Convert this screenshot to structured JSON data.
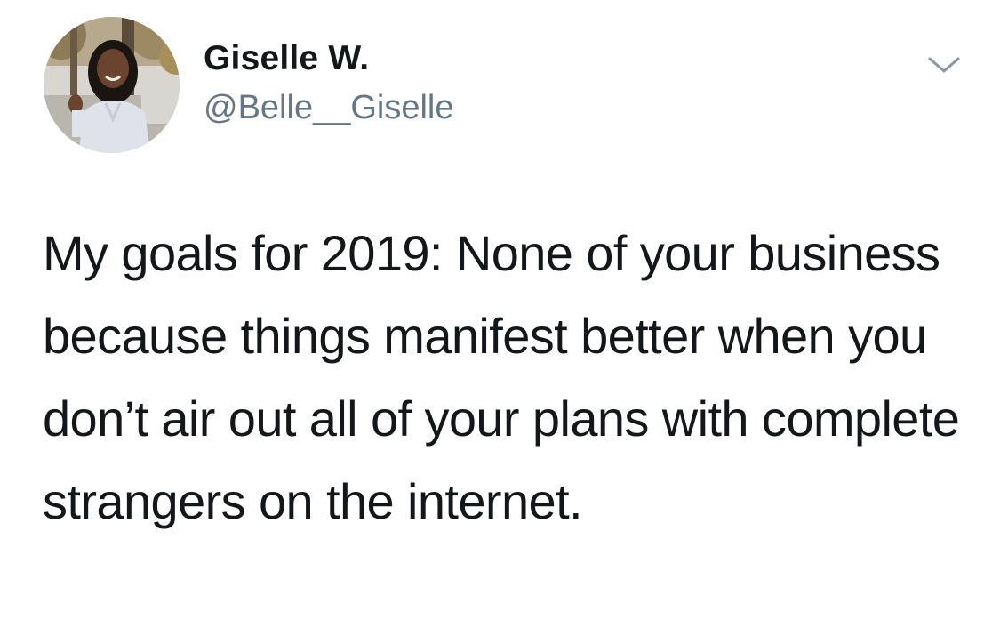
{
  "author": {
    "display_name": "Giselle W.",
    "handle": "@Belle__Giselle",
    "avatar_icon": "profile-photo"
  },
  "tweet": {
    "text": "My goals for 2019: None of your business because things manifest better when you don’t air out all of your plans with complete strangers on the internet."
  },
  "controls": {
    "more_icon": "chevron-down-icon"
  },
  "colors": {
    "text": "#14171a",
    "secondary": "#657786",
    "caret": "#8899a6",
    "background": "#ffffff"
  }
}
